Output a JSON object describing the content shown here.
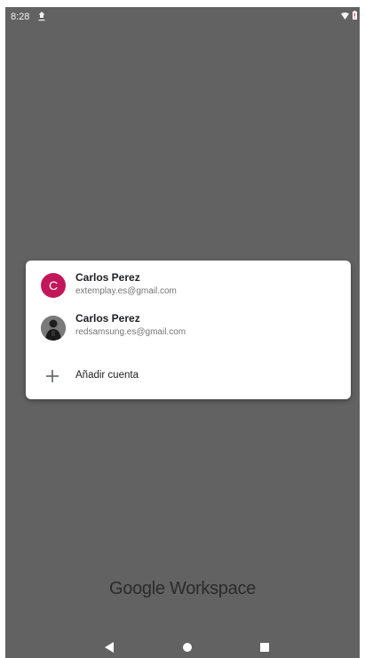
{
  "status_bar": {
    "time": "8:28",
    "icons": [
      "upload-icon",
      "wifi-icon",
      "battery-alert-icon"
    ]
  },
  "account_chooser": {
    "accounts": [
      {
        "avatar_letter": "C",
        "avatar_color": "#c2185b",
        "name": "Carlos Perez",
        "email": "extemplay.es@gmail.com"
      },
      {
        "avatar_type": "photo",
        "name": "Carlos Perez",
        "email": "redsamsung.es@gmail.com"
      }
    ],
    "add_account_label": "Añadir cuenta",
    "add_account_icon": "plus-icon"
  },
  "branding": {
    "google": "Google",
    "workspace": "Workspace"
  },
  "nav_bar": {
    "icons": [
      "back-icon",
      "home-icon",
      "recents-icon"
    ]
  },
  "colors": {
    "scrim": "#626262",
    "card": "#ffffff",
    "avatar_accent": "#c2185b",
    "battery_alert": "#e53935"
  }
}
